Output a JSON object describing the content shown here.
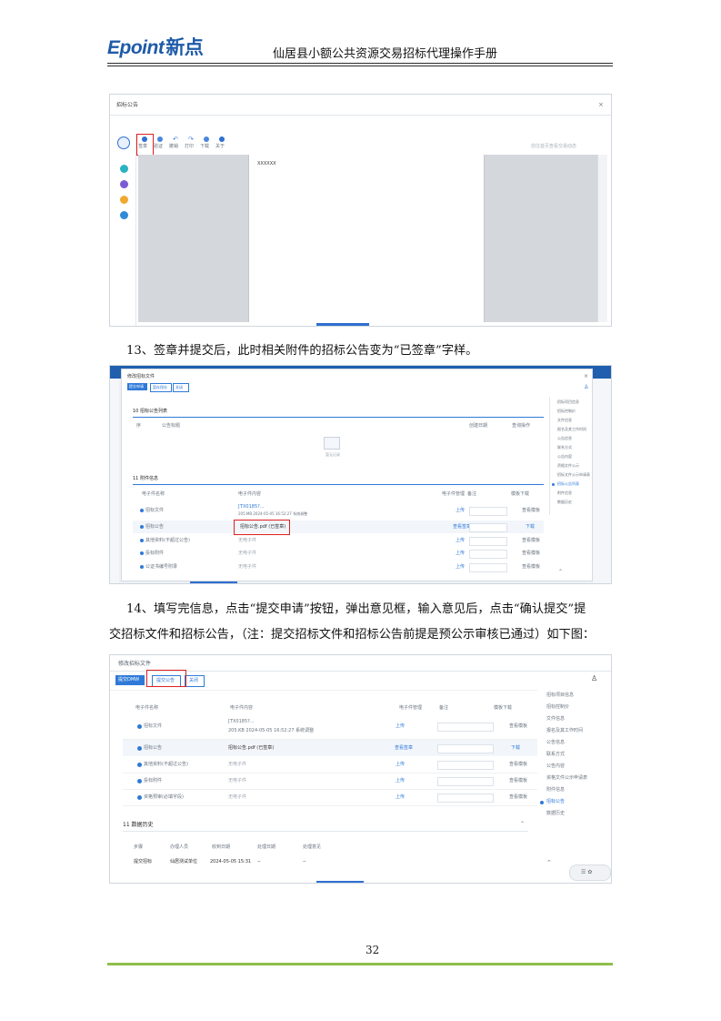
{
  "header": {
    "logo_en": "Epoint",
    "logo_cn": "新点",
    "title": "仙居县小额公共资源交易招标代理操作手册"
  },
  "shot1": {
    "window_title": "招标公告",
    "toolbar": [
      "签章",
      "验证",
      "撤销",
      "打印",
      "下载",
      "关于"
    ],
    "right_hint": "前往首页查看交易动态",
    "doc_text": "XXXXXX"
  },
  "step13": "13、签章并提交后，此时相关附件的招标公告变为“已签章”字样。",
  "shot2": {
    "window_title": "修改招标文件",
    "buttons": [
      "提交申请",
      "暂存保存",
      "关闭"
    ],
    "sec_a": "10  招标公告列表",
    "sec_a_cols": [
      "序",
      "公告标题",
      "创建日期",
      "查询操作"
    ],
    "empty_text": "暂无记录",
    "sec_b": "11  附件信息",
    "sec_b_cols": [
      "电子件名称",
      "电子件内容",
      "电子件管理",
      "备注",
      "模板下载"
    ],
    "rows": [
      {
        "name": "招标文件",
        "content": "[TX0185?...",
        "content2": "205.MB 2024-05-05 16:52:27 系统调整",
        "action": "上传",
        "tmpl": "查看模板"
      },
      {
        "name": "招标公告",
        "content": "招标公告.pdf  (已签章)",
        "content2": "",
        "action": "查看签章",
        "tmpl": "下载"
      },
      {
        "name": "其他资料(不超过公告)",
        "content": "无电子件",
        "content2": "",
        "action": "上传",
        "tmpl": "查看模板"
      },
      {
        "name": "投标附件",
        "content": "无电子件",
        "content2": "",
        "action": "上传",
        "tmpl": "查看模板"
      },
      {
        "name": "公证书编号附录",
        "content": "无电子件",
        "content2": "",
        "action": "上传",
        "tmpl": "查看模板"
      }
    ],
    "nav": [
      "招标项目信息",
      "招标控制价",
      "文件信息",
      "报名及其工作时间",
      "公告信息",
      "联系方式",
      "公告内容",
      "资格文件公示",
      "招标文件公示申请表",
      "招标公告列表",
      "附件信息",
      "数据历史"
    ]
  },
  "step14_line1": "14、填写完信息，点击“提交申请”按钮，弹出意见框，输入意见后，点击“确认提交”提",
  "step14_line2": "交招标文件和招标公告，（注：提交招标文件和招标公告前提是预公示审核已通过）如下图：",
  "shot3": {
    "window_title": "修改招标文件",
    "buttons": [
      "提交DMW",
      "提交公告",
      "关闭"
    ],
    "cols": [
      "电子件名称",
      "电子件内容",
      "电子件管理",
      "备注",
      "模板下载"
    ],
    "rows": [
      {
        "name": "招标文件",
        "content": "[TX0185?...",
        "content2": "205.KB 2024-05-05 16:52:27 系统调整",
        "action": "上传",
        "tmpl": "查看模板"
      },
      {
        "name": "招标公告",
        "content": "招标公告.pdf  (已签章)",
        "content2": "",
        "action": "查看签章",
        "tmpl": "下载"
      },
      {
        "name": "其他资料(不超过公告)",
        "content": "无电子件",
        "content2": "",
        "action": "上传",
        "tmpl": "查看模板"
      },
      {
        "name": "投标附件",
        "content": "无电子件",
        "content2": "",
        "action": "上传",
        "tmpl": "查看模板"
      },
      {
        "name": "资格预审(必填字段)",
        "content": "无电子件",
        "content2": "",
        "action": "上传",
        "tmpl": "查看模板"
      }
    ],
    "history": "11  数据历史",
    "hist_cols": [
      "步骤",
      "办理人员",
      "收到日期",
      "处理日期",
      "处理意见"
    ],
    "hist_row": [
      "提交招标",
      "仙居测试单位",
      "2024-05-05 15:31",
      "--",
      "--"
    ],
    "nav": [
      "招标项目信息",
      "招标控制价",
      "文件信息",
      "报名及其工作时间",
      "公告信息",
      "联系方式",
      "公告内容",
      "资格文件公示申请表",
      "附件信息",
      "招标公告",
      "数据历史"
    ]
  },
  "page_number": "32"
}
